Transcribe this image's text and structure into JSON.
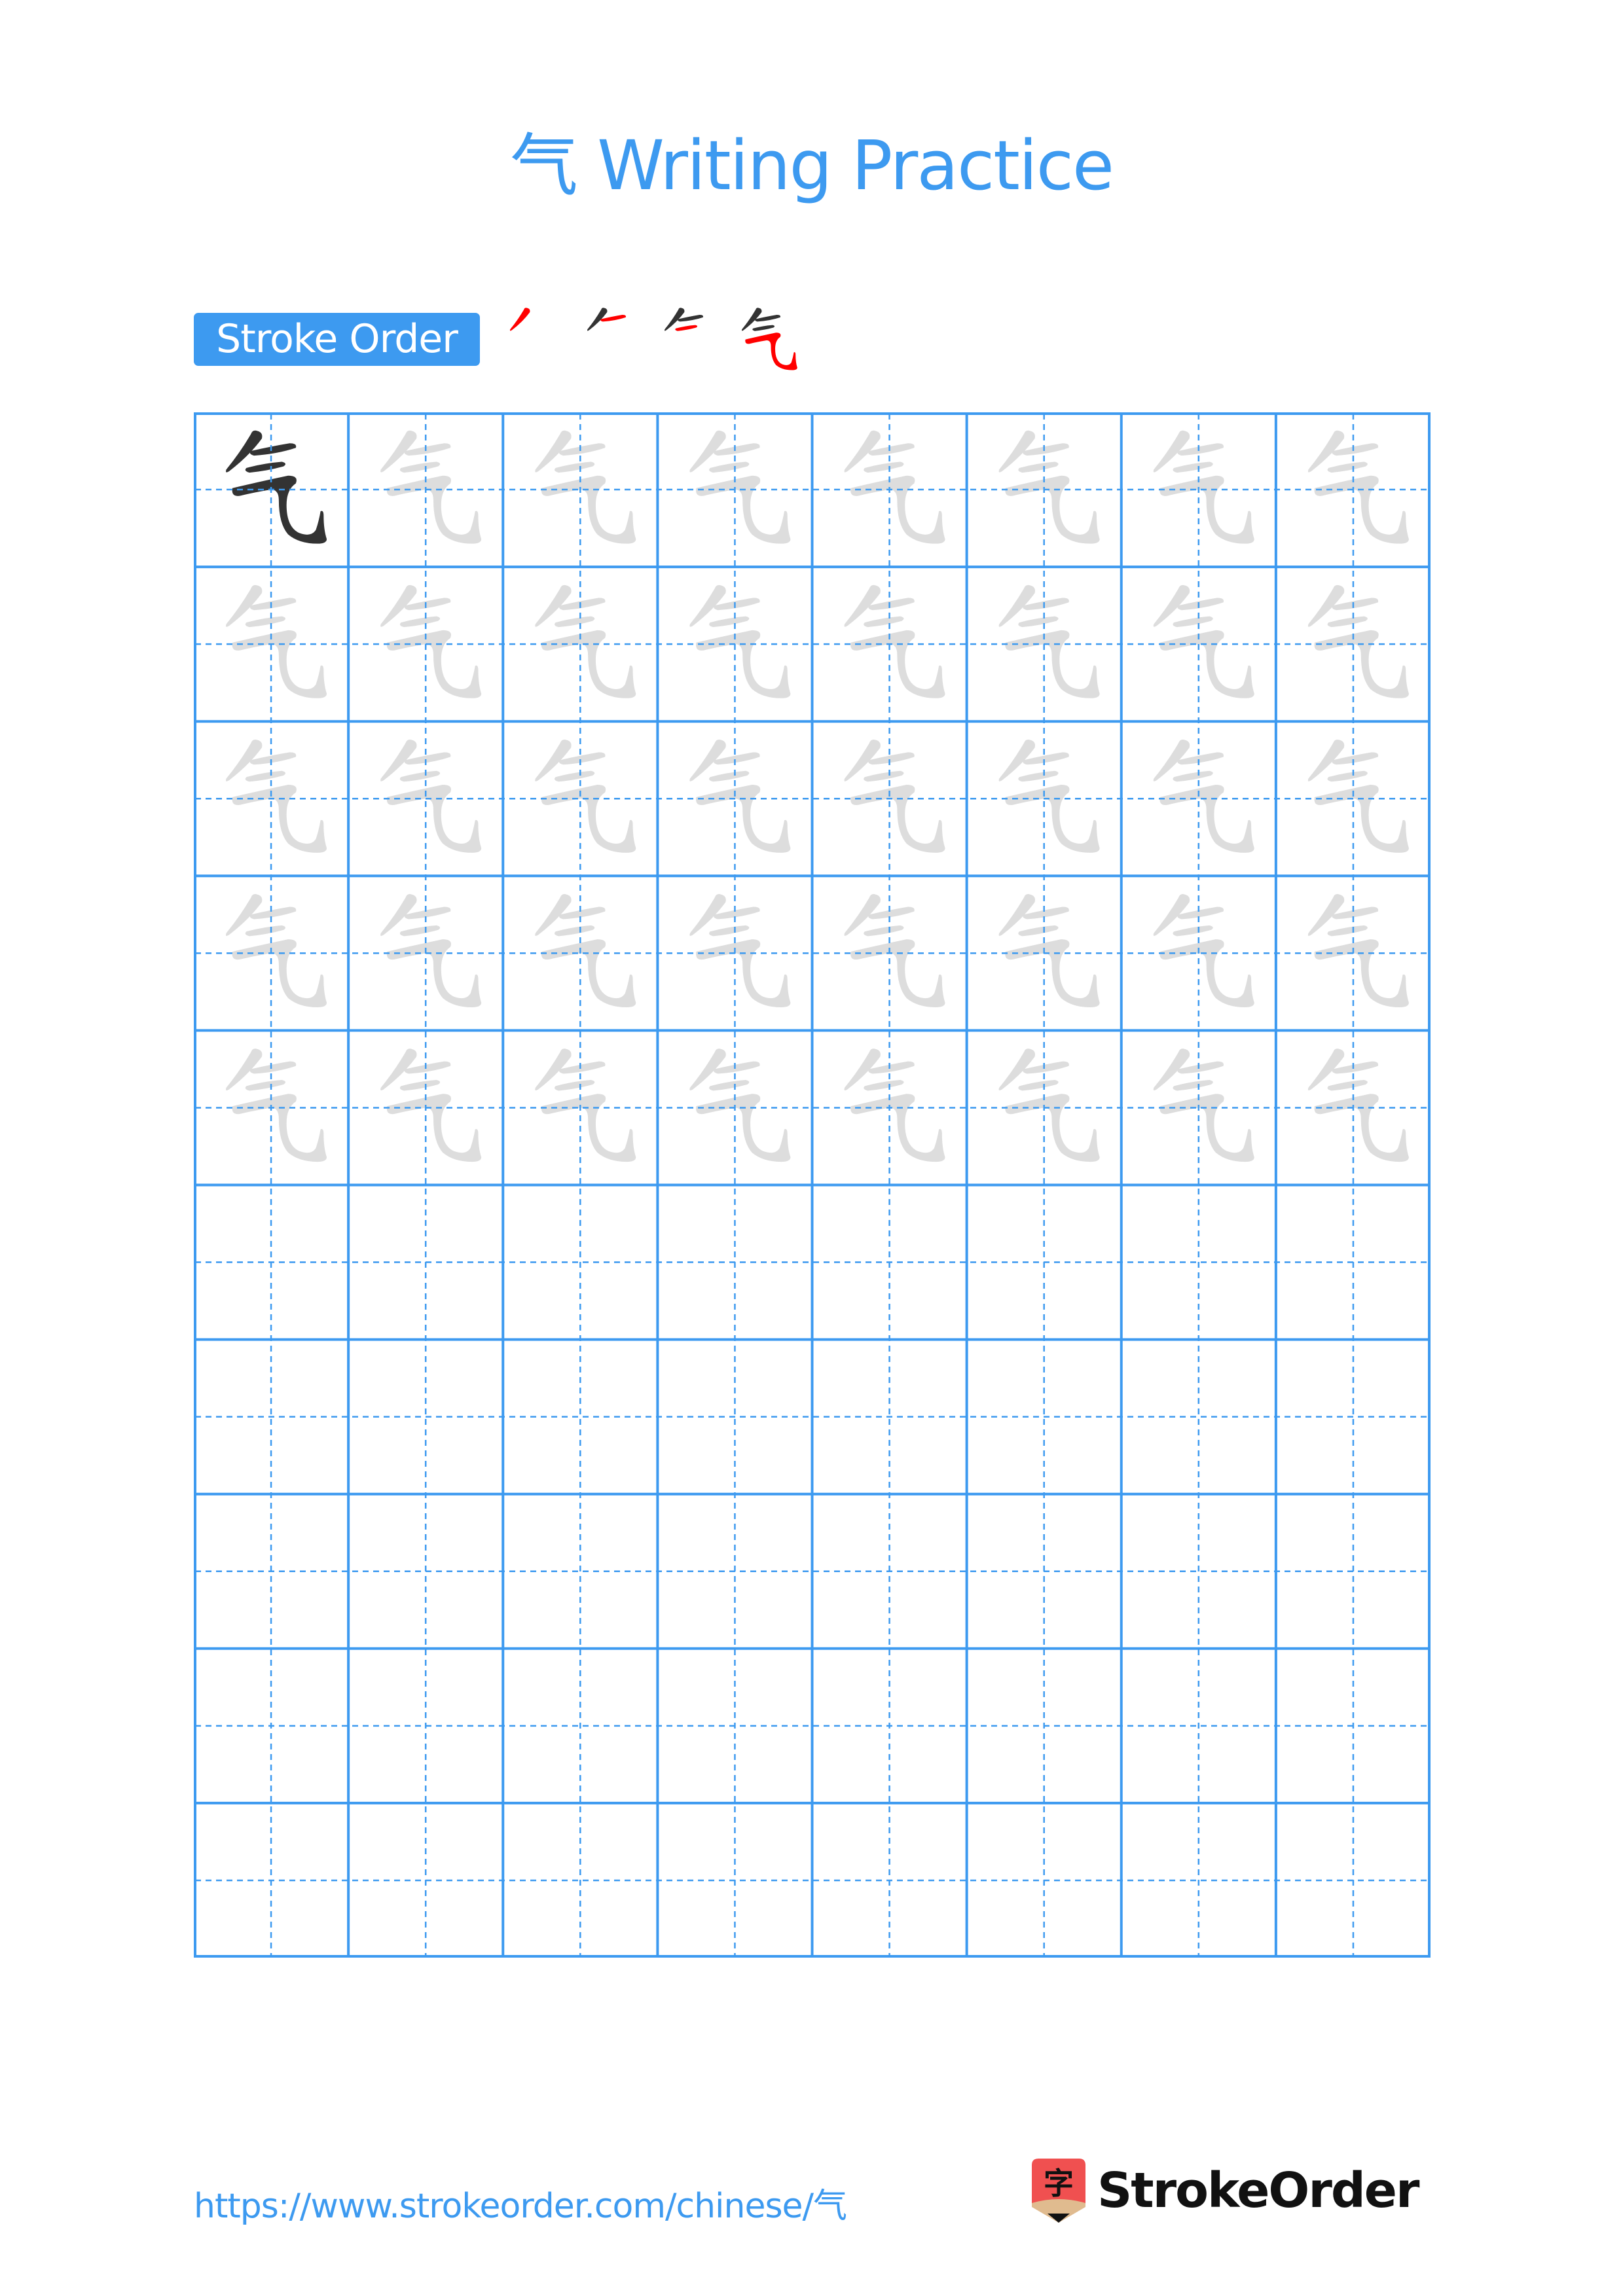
{
  "page": {
    "title_char": "气",
    "title_text": "Writing Practice",
    "accent_color": "#3d9af0"
  },
  "stroke_order": {
    "label": "Stroke Order",
    "stroke_count": 4,
    "highlight_color": "#ff0000",
    "done_color": "#333333"
  },
  "practice_grid": {
    "character": "气",
    "columns": 8,
    "rows": 10,
    "model_cells": 1,
    "trace_rows": 5,
    "model_color": "#333333",
    "trace_color": "#dddddd",
    "line_color": "#3d9af0"
  },
  "footer": {
    "url": "https://www.strokeorder.com/chinese/气",
    "brand": "StrokeOrder",
    "logo_glyph": "字"
  }
}
